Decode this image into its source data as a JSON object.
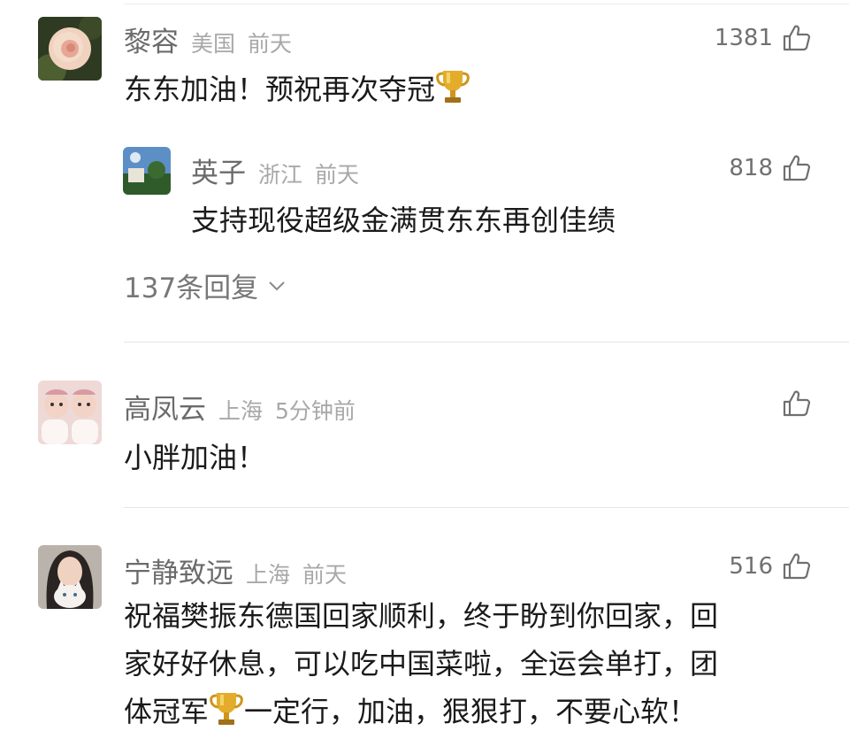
{
  "comments": [
    {
      "name": "黎容",
      "region": "美国",
      "time": "前天",
      "likes": "1381",
      "text": "东东加油！预祝再次夺冠",
      "emoji": "trophy-icon",
      "reply_preview": {
        "name": "英子",
        "region": "浙江",
        "time": "前天",
        "likes": "818",
        "text": "支持现役超级金满贯东东再创佳绩"
      },
      "replies_label": "137条回复"
    },
    {
      "name": "高凤云",
      "region": "上海",
      "time": "5分钟前",
      "likes": "",
      "text": "小胖加油！"
    },
    {
      "name": "宁静致远",
      "region": "上海",
      "time": "前天",
      "likes": "516",
      "text_line1": "祝福樊振东德国回家顺利，终于盼到你回家，回",
      "text_line2": "家好好休息，可以吃中国菜啦，全运会单打，团",
      "text_line3a": "体冠军",
      "text_line3b": "一定行，加油，狠狠打，不要心软！"
    }
  ],
  "colors": {
    "name": "#6b6b6b",
    "meta": "#a8a8a8",
    "text": "#1a1a1a",
    "divider": "#e6e6e6",
    "trophy": "#d9a21b"
  }
}
